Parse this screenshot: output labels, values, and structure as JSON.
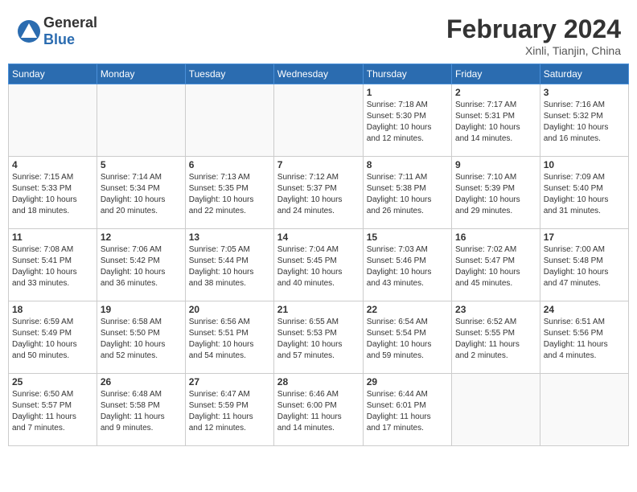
{
  "header": {
    "logo_general": "General",
    "logo_blue": "Blue",
    "month_title": "February 2024",
    "location": "Xinli, Tianjin, China"
  },
  "weekdays": [
    "Sunday",
    "Monday",
    "Tuesday",
    "Wednesday",
    "Thursday",
    "Friday",
    "Saturday"
  ],
  "weeks": [
    [
      {
        "day": "",
        "lines": []
      },
      {
        "day": "",
        "lines": []
      },
      {
        "day": "",
        "lines": []
      },
      {
        "day": "",
        "lines": []
      },
      {
        "day": "1",
        "lines": [
          "Sunrise: 7:18 AM",
          "Sunset: 5:30 PM",
          "Daylight: 10 hours",
          "and 12 minutes."
        ]
      },
      {
        "day": "2",
        "lines": [
          "Sunrise: 7:17 AM",
          "Sunset: 5:31 PM",
          "Daylight: 10 hours",
          "and 14 minutes."
        ]
      },
      {
        "day": "3",
        "lines": [
          "Sunrise: 7:16 AM",
          "Sunset: 5:32 PM",
          "Daylight: 10 hours",
          "and 16 minutes."
        ]
      }
    ],
    [
      {
        "day": "4",
        "lines": [
          "Sunrise: 7:15 AM",
          "Sunset: 5:33 PM",
          "Daylight: 10 hours",
          "and 18 minutes."
        ]
      },
      {
        "day": "5",
        "lines": [
          "Sunrise: 7:14 AM",
          "Sunset: 5:34 PM",
          "Daylight: 10 hours",
          "and 20 minutes."
        ]
      },
      {
        "day": "6",
        "lines": [
          "Sunrise: 7:13 AM",
          "Sunset: 5:35 PM",
          "Daylight: 10 hours",
          "and 22 minutes."
        ]
      },
      {
        "day": "7",
        "lines": [
          "Sunrise: 7:12 AM",
          "Sunset: 5:37 PM",
          "Daylight: 10 hours",
          "and 24 minutes."
        ]
      },
      {
        "day": "8",
        "lines": [
          "Sunrise: 7:11 AM",
          "Sunset: 5:38 PM",
          "Daylight: 10 hours",
          "and 26 minutes."
        ]
      },
      {
        "day": "9",
        "lines": [
          "Sunrise: 7:10 AM",
          "Sunset: 5:39 PM",
          "Daylight: 10 hours",
          "and 29 minutes."
        ]
      },
      {
        "day": "10",
        "lines": [
          "Sunrise: 7:09 AM",
          "Sunset: 5:40 PM",
          "Daylight: 10 hours",
          "and 31 minutes."
        ]
      }
    ],
    [
      {
        "day": "11",
        "lines": [
          "Sunrise: 7:08 AM",
          "Sunset: 5:41 PM",
          "Daylight: 10 hours",
          "and 33 minutes."
        ]
      },
      {
        "day": "12",
        "lines": [
          "Sunrise: 7:06 AM",
          "Sunset: 5:42 PM",
          "Daylight: 10 hours",
          "and 36 minutes."
        ]
      },
      {
        "day": "13",
        "lines": [
          "Sunrise: 7:05 AM",
          "Sunset: 5:44 PM",
          "Daylight: 10 hours",
          "and 38 minutes."
        ]
      },
      {
        "day": "14",
        "lines": [
          "Sunrise: 7:04 AM",
          "Sunset: 5:45 PM",
          "Daylight: 10 hours",
          "and 40 minutes."
        ]
      },
      {
        "day": "15",
        "lines": [
          "Sunrise: 7:03 AM",
          "Sunset: 5:46 PM",
          "Daylight: 10 hours",
          "and 43 minutes."
        ]
      },
      {
        "day": "16",
        "lines": [
          "Sunrise: 7:02 AM",
          "Sunset: 5:47 PM",
          "Daylight: 10 hours",
          "and 45 minutes."
        ]
      },
      {
        "day": "17",
        "lines": [
          "Sunrise: 7:00 AM",
          "Sunset: 5:48 PM",
          "Daylight: 10 hours",
          "and 47 minutes."
        ]
      }
    ],
    [
      {
        "day": "18",
        "lines": [
          "Sunrise: 6:59 AM",
          "Sunset: 5:49 PM",
          "Daylight: 10 hours",
          "and 50 minutes."
        ]
      },
      {
        "day": "19",
        "lines": [
          "Sunrise: 6:58 AM",
          "Sunset: 5:50 PM",
          "Daylight: 10 hours",
          "and 52 minutes."
        ]
      },
      {
        "day": "20",
        "lines": [
          "Sunrise: 6:56 AM",
          "Sunset: 5:51 PM",
          "Daylight: 10 hours",
          "and 54 minutes."
        ]
      },
      {
        "day": "21",
        "lines": [
          "Sunrise: 6:55 AM",
          "Sunset: 5:53 PM",
          "Daylight: 10 hours",
          "and 57 minutes."
        ]
      },
      {
        "day": "22",
        "lines": [
          "Sunrise: 6:54 AM",
          "Sunset: 5:54 PM",
          "Daylight: 10 hours",
          "and 59 minutes."
        ]
      },
      {
        "day": "23",
        "lines": [
          "Sunrise: 6:52 AM",
          "Sunset: 5:55 PM",
          "Daylight: 11 hours",
          "and 2 minutes."
        ]
      },
      {
        "day": "24",
        "lines": [
          "Sunrise: 6:51 AM",
          "Sunset: 5:56 PM",
          "Daylight: 11 hours",
          "and 4 minutes."
        ]
      }
    ],
    [
      {
        "day": "25",
        "lines": [
          "Sunrise: 6:50 AM",
          "Sunset: 5:57 PM",
          "Daylight: 11 hours",
          "and 7 minutes."
        ]
      },
      {
        "day": "26",
        "lines": [
          "Sunrise: 6:48 AM",
          "Sunset: 5:58 PM",
          "Daylight: 11 hours",
          "and 9 minutes."
        ]
      },
      {
        "day": "27",
        "lines": [
          "Sunrise: 6:47 AM",
          "Sunset: 5:59 PM",
          "Daylight: 11 hours",
          "and 12 minutes."
        ]
      },
      {
        "day": "28",
        "lines": [
          "Sunrise: 6:46 AM",
          "Sunset: 6:00 PM",
          "Daylight: 11 hours",
          "and 14 minutes."
        ]
      },
      {
        "day": "29",
        "lines": [
          "Sunrise: 6:44 AM",
          "Sunset: 6:01 PM",
          "Daylight: 11 hours",
          "and 17 minutes."
        ]
      },
      {
        "day": "",
        "lines": []
      },
      {
        "day": "",
        "lines": []
      }
    ]
  ]
}
